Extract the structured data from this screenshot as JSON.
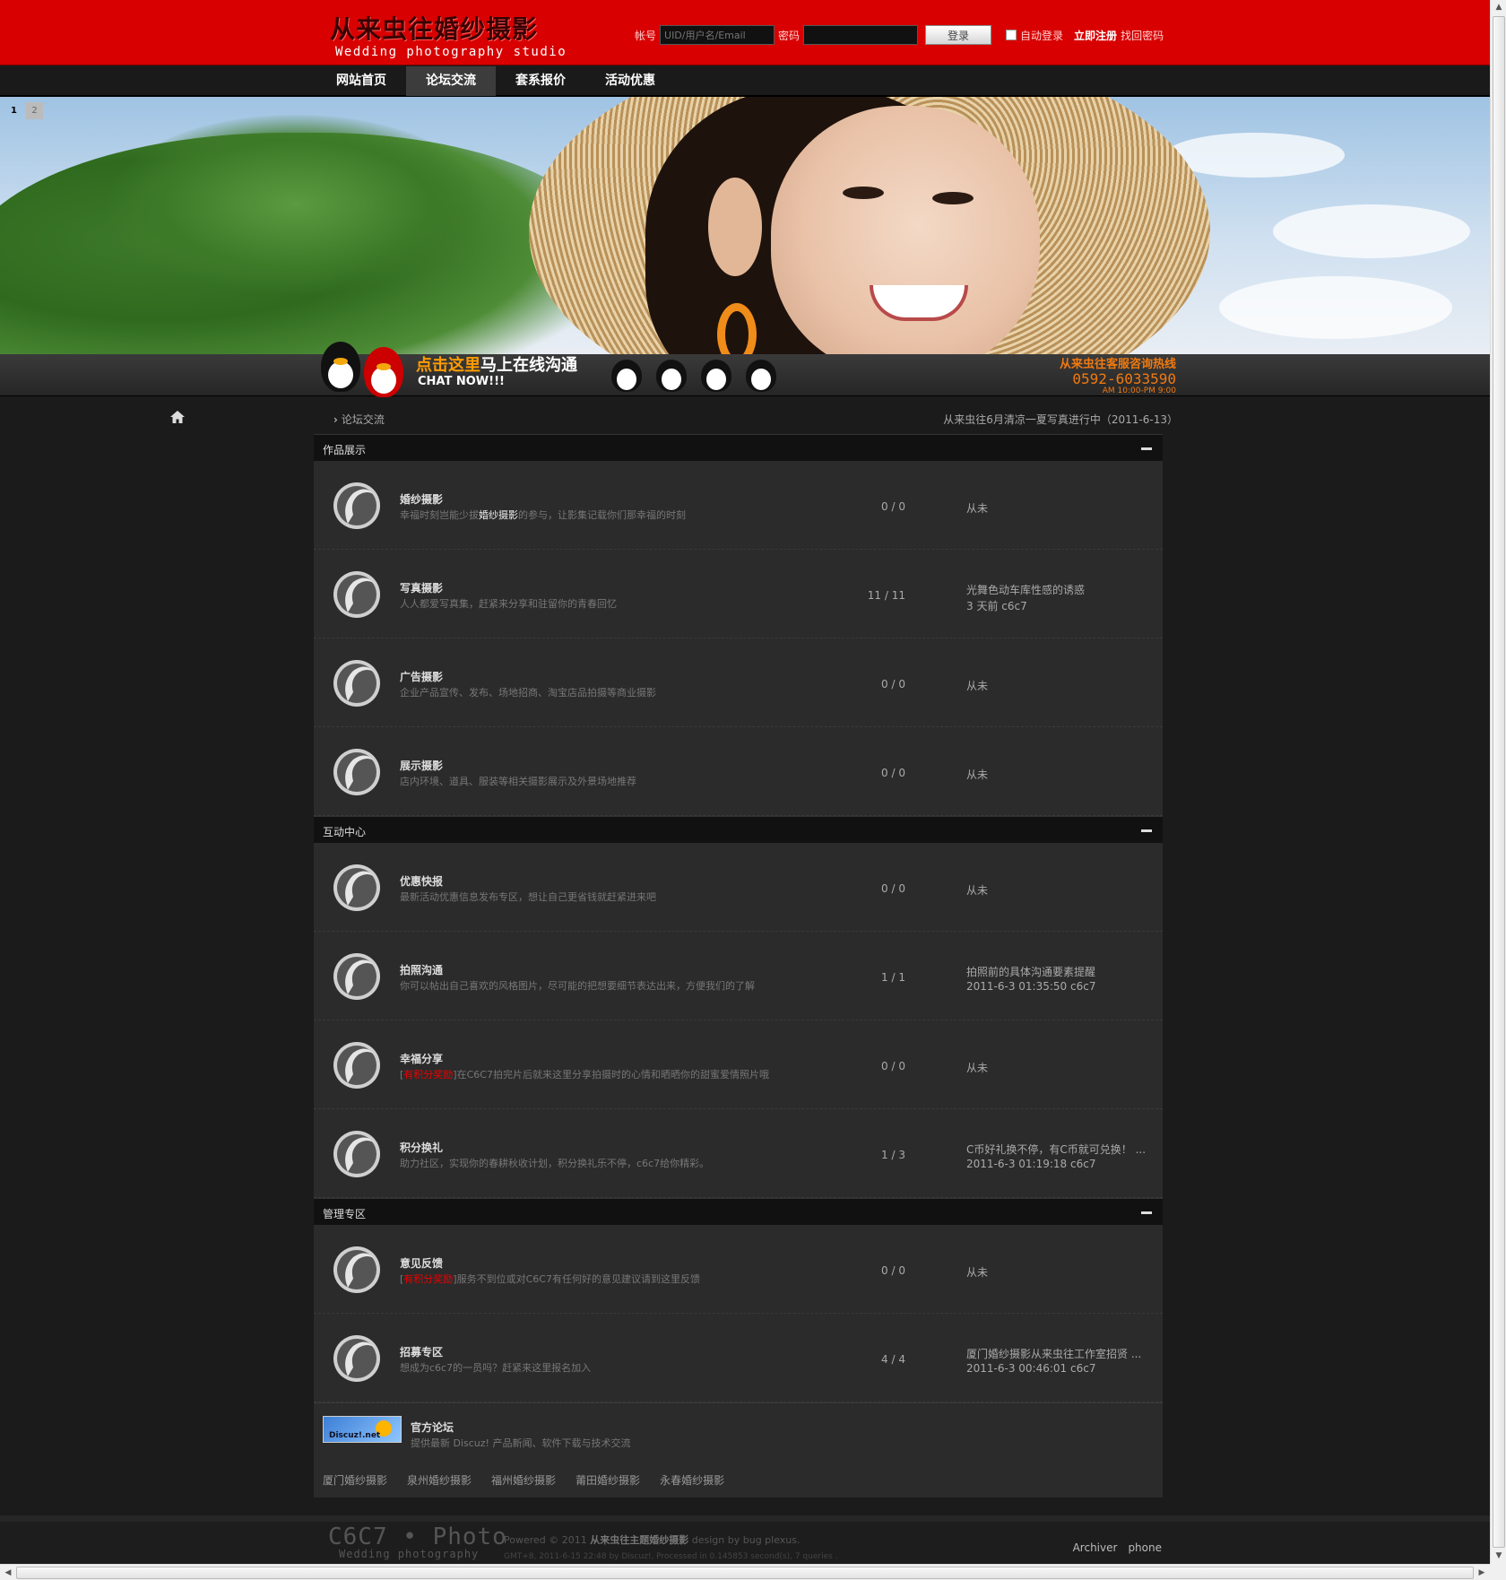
{
  "header": {
    "logo_cn": "从来虫往婚纱摄影",
    "logo_en": "Wedding photography studio",
    "account_label": "帐号",
    "account_placeholder": "UID/用户名/Email",
    "password_label": "密码",
    "login_button": "登录",
    "auto_login_label": "自动登录",
    "register_link": "立即注册",
    "find_password_link": "找回密码"
  },
  "nav": {
    "items": [
      {
        "label": "网站首页",
        "active": false
      },
      {
        "label": "论坛交流",
        "active": true
      },
      {
        "label": "套系报价",
        "active": false
      },
      {
        "label": "活动优惠",
        "active": false
      }
    ]
  },
  "slider": {
    "pages": [
      "1",
      "2"
    ]
  },
  "chat": {
    "highlight": "点击这里",
    "rest": "马上在线沟通",
    "english": "CHAT NOW!!!",
    "hotline_title": "从来虫往客服咨询热线",
    "hotline_phone": "0592-6033590",
    "hotline_hours": "AM 10:00-PM 9:00"
  },
  "breadcrumb": {
    "current": "论坛交流"
  },
  "notice": "从来虫往6月清凉一夏写真进行中（2011-6-13）",
  "categories": [
    {
      "title": "作品展示",
      "forums": [
        {
          "name": "婚纱摄影",
          "desc_pre": "幸福时刻岂能少拔",
          "desc_hl": "婚纱摄影",
          "desc_post": "的参与，让影集记载你们那幸福的时刻",
          "count": "0 / 0",
          "last": "从未"
        },
        {
          "name": "写真摄影",
          "desc": "人人都爱写真集，赶紧来分享和驻留你的青春回忆",
          "count": "11 / 11",
          "last_title": "光舞色动车库性感的诱惑",
          "last_info": "3 天前 c6c7"
        },
        {
          "name": "广告摄影",
          "desc": "企业产品宣传、发布、场地招商、淘宝店品拍摄等商业摄影",
          "count": "0 / 0",
          "last": "从未"
        },
        {
          "name": "展示摄影",
          "desc": "店内环境、道具、服装等相关摄影展示及外景场地推荐",
          "count": "0 / 0",
          "last": "从未"
        }
      ]
    },
    {
      "title": "互动中心",
      "forums": [
        {
          "name": "优惠快报",
          "desc": "最新活动优惠信息发布专区，想让自己更省钱就赶紧进来吧",
          "count": "0 / 0",
          "last": "从未"
        },
        {
          "name": "拍照沟通",
          "desc": "你可以帖出自己喜欢的风格图片，尽可能的把想要细节表达出来，方便我们的了解",
          "count": "1 / 1",
          "last_title": "拍照前的具体沟通要素提醒",
          "last_info": "2011-6-3 01:35:50 c6c7"
        },
        {
          "name": "幸福分享",
          "desc_red": "有积分奖励",
          "desc": "在C6C7拍完片后就来这里分享拍摄时的心情和晒晒你的甜蜜爱情照片哦",
          "count": "0 / 0",
          "last": "从未"
        },
        {
          "name": "积分换礼",
          "desc": "助力社区，实现你的春耕秋收计划，积分换礼乐不停，c6c7给你精彩。",
          "count": "1 / 3",
          "last_title": "C币好礼换不停，有C币就可兑换！ ...",
          "last_info": "2011-6-3 01:19:18 c6c7"
        }
      ]
    },
    {
      "title": "管理专区",
      "forums": [
        {
          "name": "意见反馈",
          "desc_red": "有积分奖励",
          "desc": "服务不到位或对C6C7有任何好的意见建议请到这里反馈",
          "count": "0 / 0",
          "last": "从未"
        },
        {
          "name": "招募专区",
          "desc": "想成为c6c7的一员吗？赶紧来这里报名加入",
          "count": "4 / 4",
          "last_title": "厦门婚纱摄影从来虫往工作室招贤 ...",
          "last_info": "2011-6-3 00:46:01 c6c7"
        }
      ]
    }
  ],
  "official": {
    "logo_text": "Discuz!.net",
    "name": "官方论坛",
    "desc": "提供最新 Discuz! 产品新闻、软件下载与技术交流"
  },
  "links": [
    "厦门婚纱摄影",
    "泉州婚纱摄影",
    "福州婚纱摄影",
    "莆田婚纱摄影",
    "永春婚纱摄影"
  ],
  "footer": {
    "logo_big": "C6C7 • Photo",
    "logo_small": "Wedding photography",
    "powered_pre": "Powered © 2011",
    "powered_bold": "从来虫往主题婚纱摄影",
    "powered_post": "design by bug plexus.",
    "processed": "GMT+8, 2011-6-15 22:48 by Discuz!, Processed in 0.145853 second(s), 7 queries .",
    "links": [
      "Archiver",
      "phone"
    ]
  }
}
